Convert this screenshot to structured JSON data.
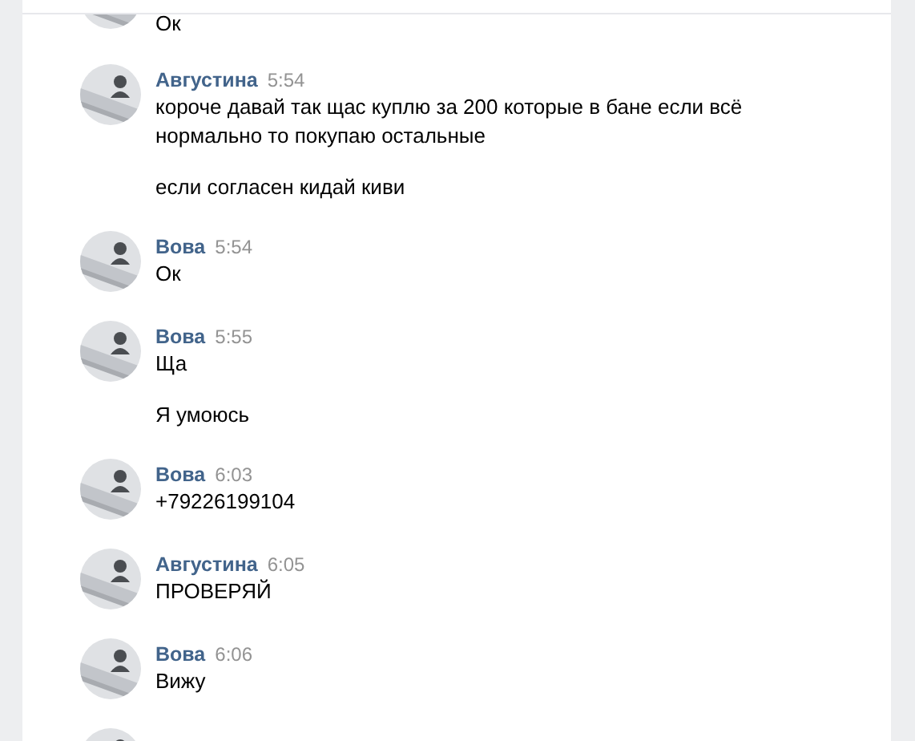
{
  "messages": [
    {
      "avatar": {
        "kind": "picture"
      },
      "paragraphs": [
        [
          "Ок"
        ]
      ]
    },
    {
      "avatar": {
        "kind": "picture"
      },
      "author": "Августина",
      "time": "5:54",
      "paragraphs": [
        [
          "короче давай так щас куплю за 200 которые в бане если всё",
          "нормально то покупаю остальные"
        ],
        [
          "если согласен кидай киви"
        ]
      ]
    },
    {
      "avatar": {
        "kind": "picture"
      },
      "author": "Вова",
      "time": "5:54",
      "paragraphs": [
        [
          "Ок"
        ]
      ]
    },
    {
      "avatar": {
        "kind": "picture"
      },
      "author": "Вова",
      "time": "5:55",
      "paragraphs": [
        [
          "Ща"
        ],
        [
          "Я умоюсь"
        ]
      ]
    },
    {
      "avatar": {
        "kind": "picture"
      },
      "author": "Вова",
      "time": "6:03",
      "paragraphs": [
        [
          "+79226199104"
        ]
      ]
    },
    {
      "avatar": {
        "kind": "picture"
      },
      "author": "Августина",
      "time": "6:05",
      "paragraphs": [
        [
          "ПРОВЕРЯЙ"
        ]
      ]
    },
    {
      "avatar": {
        "kind": "picture"
      },
      "author": "Вова",
      "time": "6:06",
      "paragraphs": [
        [
          "Вижу"
        ]
      ]
    },
    {
      "avatar": {
        "kind": "picture"
      }
    }
  ]
}
